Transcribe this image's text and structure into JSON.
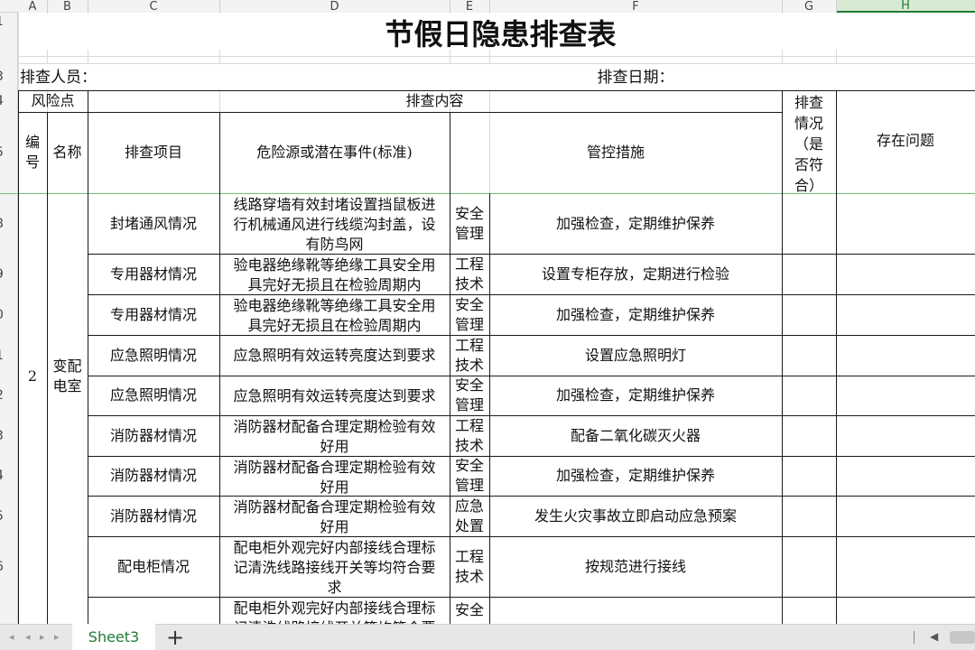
{
  "column_headers": [
    "A",
    "B",
    "C",
    "D",
    "E",
    "F",
    "G",
    "H"
  ],
  "selected_column": "H",
  "row_headers": [
    "1",
    "3",
    "4",
    "5",
    "8",
    "9",
    "0",
    "1",
    "2",
    "3",
    "4",
    "5",
    "6"
  ],
  "title": "节假日隐患排查表",
  "inspector_label": "排查人员：",
  "date_label": "排查日期：",
  "header": {
    "risk_point": "风险点",
    "content": "排查内容",
    "status": "排查情况（是否符合）",
    "status_lines": [
      "排查",
      "情况",
      "（是",
      "否符",
      "合）"
    ],
    "problems": "存在问题",
    "number": "编号",
    "number_lines": [
      "编",
      "号"
    ],
    "name": "名称",
    "item": "排查项目",
    "hazard": "危险源或潜在事件(标准)",
    "measures": "管控措施"
  },
  "group": {
    "number": "2",
    "name_lines": [
      "变配",
      "电室"
    ]
  },
  "rows": [
    {
      "item": "封堵通风情况",
      "hazard_lines": [
        "线路穿墙有效封堵设置挡鼠板进",
        "行机械通风进行线缆沟封盖，设",
        "有防鸟网"
      ],
      "type_lines": [
        "安全",
        "管理"
      ],
      "measure": "加强检查，定期维护保养"
    },
    {
      "item": "专用器材情况",
      "hazard_lines": [
        "验电器绝缘靴等绝缘工具安全用",
        "具完好无损且在检验周期内"
      ],
      "type_lines": [
        "工程",
        "技术"
      ],
      "measure": "设置专柜存放，定期进行检验"
    },
    {
      "item": "专用器材情况",
      "hazard_lines": [
        "验电器绝缘靴等绝缘工具安全用",
        "具完好无损且在检验周期内"
      ],
      "type_lines": [
        "安全",
        "管理"
      ],
      "measure": "加强检查，定期维护保养"
    },
    {
      "item": "应急照明情况",
      "hazard_lines": [
        "应急照明有效运转亮度达到要求"
      ],
      "type_lines": [
        "工程",
        "技术"
      ],
      "measure": "设置应急照明灯"
    },
    {
      "item": "应急照明情况",
      "hazard_lines": [
        "应急照明有效运转亮度达到要求"
      ],
      "type_lines": [
        "安全",
        "管理"
      ],
      "measure": "加强检查，定期维护保养"
    },
    {
      "item": "消防器材情况",
      "hazard_lines": [
        "消防器材配备合理定期检验有效",
        "好用"
      ],
      "type_lines": [
        "工程",
        "技术"
      ],
      "measure": "配备二氧化碳灭火器"
    },
    {
      "item": "消防器材情况",
      "hazard_lines": [
        "消防器材配备合理定期检验有效",
        "好用"
      ],
      "type_lines": [
        "安全",
        "管理"
      ],
      "measure": "加强检查，定期维护保养"
    },
    {
      "item": "消防器材情况",
      "hazard_lines": [
        "消防器材配备合理定期检验有效",
        "好用"
      ],
      "type_lines": [
        "应急",
        "处置"
      ],
      "measure": "发生火灾事故立即启动应急预案"
    },
    {
      "item": "配电柜情况",
      "hazard_lines": [
        "配电柜外观完好内部接线合理标",
        "记清洗线路接线开关等均符合要",
        "求"
      ],
      "type_lines": [
        "工程",
        "技术"
      ],
      "measure": "按规范进行接线"
    },
    {
      "item": "",
      "hazard_lines": [
        "配电柜外观完好内部接线合理标",
        "记清洗线路接线开关等均符合要"
      ],
      "type_lines": [
        "安全"
      ],
      "measure": ""
    }
  ],
  "sheet_tab": "Sheet3",
  "add_sheet": "+",
  "colors": {
    "grid": "#d9d9d9",
    "border": "#1a1a1a",
    "tab_text": "#1e7b34",
    "selected_col": "#d8ead3"
  }
}
